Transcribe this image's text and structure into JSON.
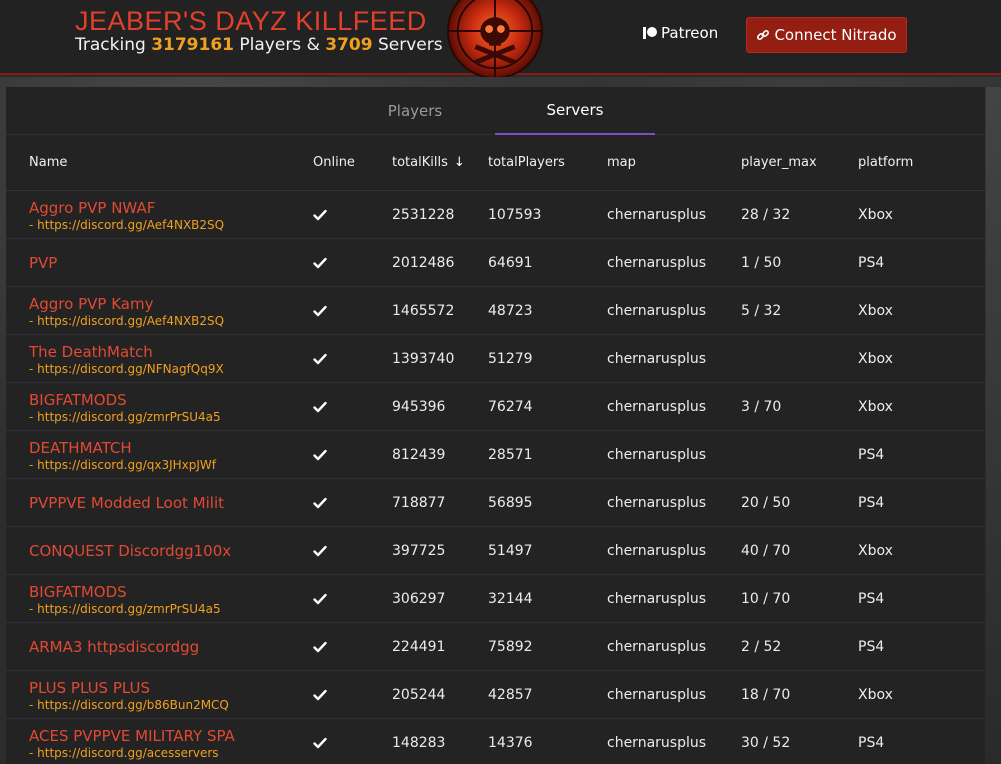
{
  "header": {
    "title": "JEABER'S DAYZ KILLFEED",
    "tracking_prefix": "Tracking",
    "players_count": "3179161",
    "players_label": "Players &",
    "servers_count": "3709",
    "servers_label": "Servers",
    "patreon_label": "Patreon",
    "nitrado_label": "Connect Nitrado"
  },
  "colors": {
    "accent_red": "#e04a34",
    "link_orange": "#f0a020",
    "button_red": "#951e13",
    "tab_underline": "#7b4dc7"
  },
  "tabs": [
    {
      "label": "Players",
      "active": false
    },
    {
      "label": "Servers",
      "active": true
    }
  ],
  "columns": {
    "name": "Name",
    "online": "Online",
    "totalKills": "totalKills",
    "totalPlayers": "totalPlayers",
    "map": "map",
    "player_max": "player_max",
    "platform": "platform"
  },
  "rows": [
    {
      "name": "Aggro PVP NWAF",
      "link": "- https://discord.gg/Aef4NXB2SQ",
      "online": true,
      "kills": "2531228",
      "players": "107593",
      "map": "chernarusplus",
      "player_max": "28 / 32",
      "platform": "Xbox"
    },
    {
      "name": "PVP",
      "link": "",
      "online": true,
      "kills": "2012486",
      "players": "64691",
      "map": "chernarusplus",
      "player_max": "1 / 50",
      "platform": "PS4"
    },
    {
      "name": "Aggro PVP Kamy",
      "link": "- https://discord.gg/Aef4NXB2SQ",
      "online": true,
      "kills": "1465572",
      "players": "48723",
      "map": "chernarusplus",
      "player_max": "5 / 32",
      "platform": "Xbox"
    },
    {
      "name": "The DeathMatch",
      "link": "- https://discord.gg/NFNagfQq9X",
      "online": true,
      "kills": "1393740",
      "players": "51279",
      "map": "chernarusplus",
      "player_max": "",
      "platform": "Xbox"
    },
    {
      "name": "BIGFATMODS",
      "link": "- https://discord.gg/zmrPrSU4a5",
      "online": true,
      "kills": "945396",
      "players": "76274",
      "map": "chernarusplus",
      "player_max": "3 / 70",
      "platform": "Xbox"
    },
    {
      "name": "DEATHMATCH",
      "link": "- https://discord.gg/qx3JHxpJWf",
      "online": true,
      "kills": "812439",
      "players": "28571",
      "map": "chernarusplus",
      "player_max": "",
      "platform": "PS4"
    },
    {
      "name": "PVPPVE Modded Loot Milit",
      "link": "",
      "online": true,
      "kills": "718877",
      "players": "56895",
      "map": "chernarusplus",
      "player_max": "20 / 50",
      "platform": "PS4"
    },
    {
      "name": "CONQUEST Discordgg100x",
      "link": "",
      "online": true,
      "kills": "397725",
      "players": "51497",
      "map": "chernarusplus",
      "player_max": "40 / 70",
      "platform": "Xbox"
    },
    {
      "name": "BIGFATMODS",
      "link": "- https://discord.gg/zmrPrSU4a5",
      "online": true,
      "kills": "306297",
      "players": "32144",
      "map": "chernarusplus",
      "player_max": "10 / 70",
      "platform": "PS4"
    },
    {
      "name": "ARMA3 httpsdiscordgg",
      "link": "",
      "online": true,
      "kills": "224491",
      "players": "75892",
      "map": "chernarusplus",
      "player_max": "2 / 52",
      "platform": "PS4"
    },
    {
      "name": "PLUS PLUS PLUS",
      "link": "- https://discord.gg/b86Bun2MCQ",
      "online": true,
      "kills": "205244",
      "players": "42857",
      "map": "chernarusplus",
      "player_max": "18 / 70",
      "platform": "Xbox"
    },
    {
      "name": "ACES PVPPVE MILITARY SPA",
      "link": "- https://discord.gg/acesservers",
      "online": true,
      "kills": "148283",
      "players": "14376",
      "map": "chernarusplus",
      "player_max": "30 / 52",
      "platform": "PS4"
    }
  ]
}
